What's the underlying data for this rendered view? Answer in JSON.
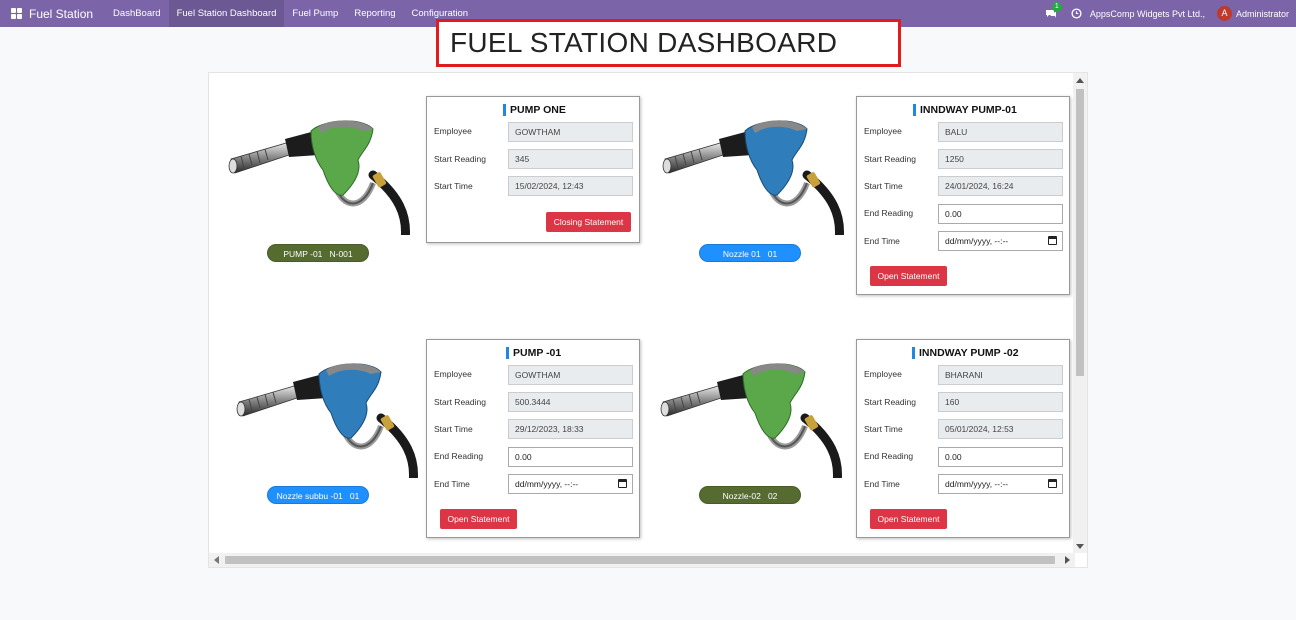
{
  "navbar": {
    "brand": "Fuel Station",
    "menu": [
      "DashBoard",
      "Fuel Station Dashboard",
      "Fuel Pump",
      "Reporting",
      "Configuration"
    ],
    "chat_badge": "1",
    "company": "AppsComp Widgets Pvt Ltd.,",
    "avatar_letter": "A",
    "user": "Administrator"
  },
  "page_title": "FUEL STATION DASHBOARD",
  "colors": {
    "navbar": "#7b65a8",
    "label_green": "#556b2f",
    "label_blue": "#1e90ff",
    "button_red": "#dc3545",
    "title_border": "#e01c1c"
  },
  "labels": {
    "employee": "Employee",
    "start_reading": "Start Reading",
    "start_time": "Start Time",
    "end_reading": "End Reading",
    "end_time": "End Time",
    "datetime_placeholder": "dd/mm/yyyy, --:--"
  },
  "pumps": [
    {
      "nozzle_label": "PUMP -01   N-001",
      "nozzle_color": "green",
      "card_title": "PUMP ONE",
      "employee": "GOWTHAM",
      "start_reading": "345",
      "start_time": "15/02/2024, 12:43",
      "button": "Closing Statement"
    },
    {
      "nozzle_label": "Nozzle 01   01",
      "nozzle_color": "blue",
      "card_title": "INNDWAY PUMP-01",
      "employee": "BALU",
      "start_reading": "1250",
      "start_time": "24/01/2024, 16:24",
      "end_reading": "0.00",
      "button": "Open Statement"
    },
    {
      "nozzle_label": "Nozzle subbu -01   01",
      "nozzle_color": "blue",
      "card_title": "PUMP -01",
      "employee": "GOWTHAM",
      "start_reading": "500.3444",
      "start_time": "29/12/2023, 18:33",
      "end_reading": "0.00",
      "button": "Open Statement"
    },
    {
      "nozzle_label": "Nozzle-02   02",
      "nozzle_color": "green",
      "card_title": "INNDWAY PUMP -02",
      "employee": "BHARANI",
      "start_reading": "160",
      "start_time": "05/01/2024, 12:53",
      "end_reading": "0.00",
      "button": "Open Statement"
    }
  ]
}
